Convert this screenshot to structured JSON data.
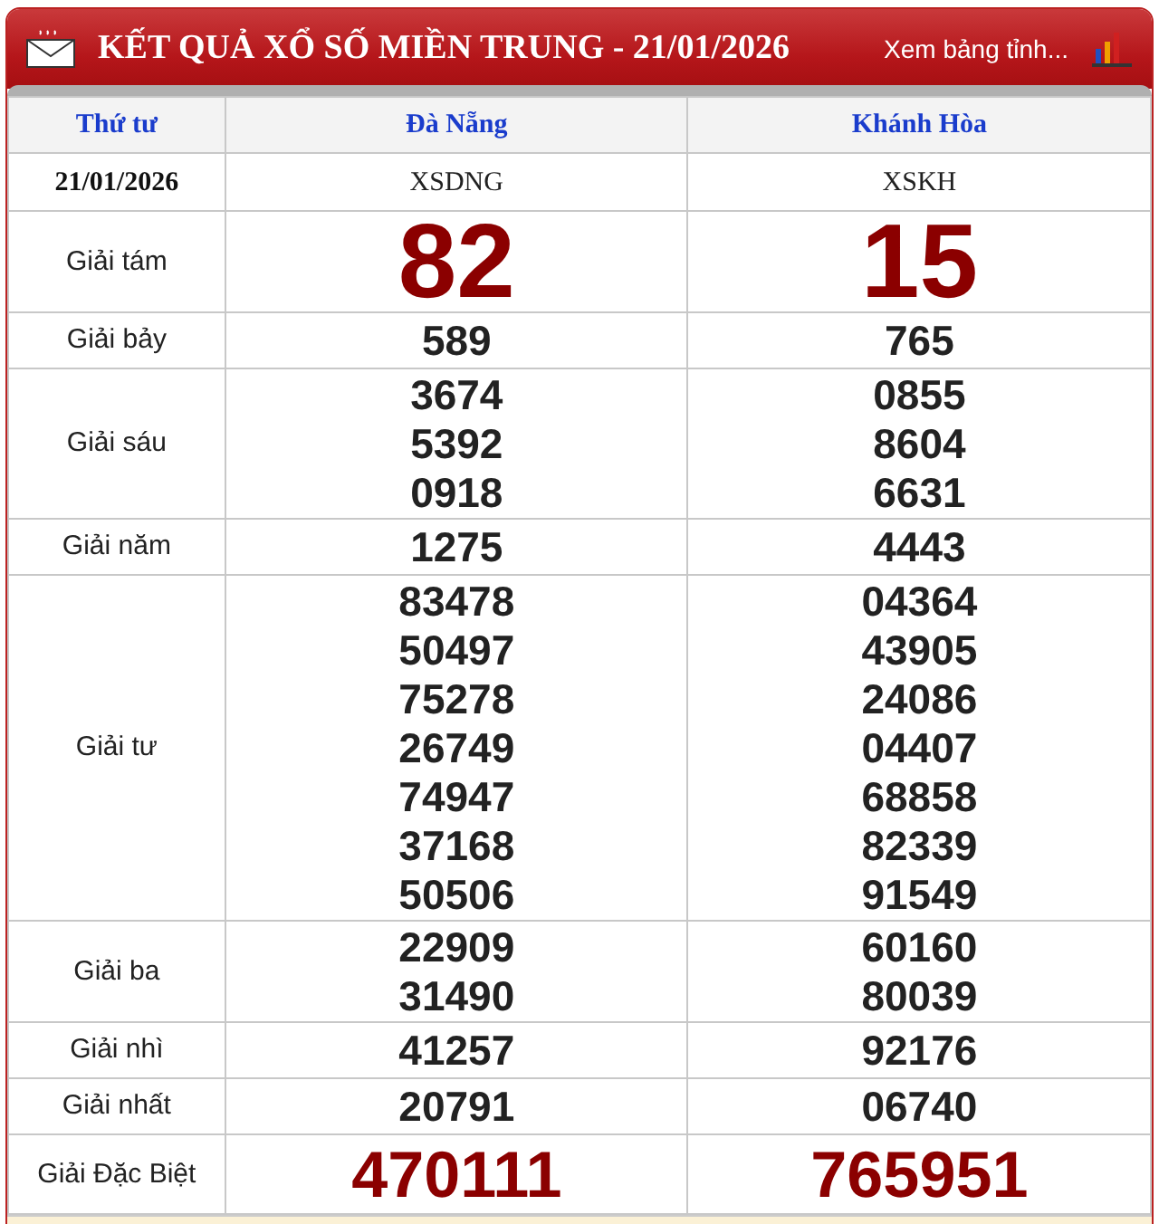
{
  "header": {
    "title": "KẾT QUẢ XỔ SỐ MIỀN TRUNG - 21/01/2026",
    "link": "Xem bảng tỉnh..."
  },
  "columns": [
    "Thứ tư",
    "Đà Nẵng",
    "Khánh Hòa"
  ],
  "code_row": {
    "date": "21/01/2026",
    "codes": [
      "XSDNG",
      "XSKH"
    ]
  },
  "prizes": [
    {
      "label": "Giải tám",
      "kind": "big",
      "results": [
        [
          "82"
        ],
        [
          "15"
        ]
      ]
    },
    {
      "label": "Giải bảy",
      "kind": "normal",
      "results": [
        [
          "589"
        ],
        [
          "765"
        ]
      ]
    },
    {
      "label": "Giải sáu",
      "kind": "normal",
      "results": [
        [
          "3674",
          "5392",
          "0918"
        ],
        [
          "0855",
          "8604",
          "6631"
        ]
      ]
    },
    {
      "label": "Giải năm",
      "kind": "normal",
      "results": [
        [
          "1275"
        ],
        [
          "4443"
        ]
      ]
    },
    {
      "label": "Giải tư",
      "kind": "normal",
      "results": [
        [
          "83478",
          "50497",
          "75278",
          "26749",
          "74947",
          "37168",
          "50506"
        ],
        [
          "04364",
          "43905",
          "24086",
          "04407",
          "68858",
          "82339",
          "91549"
        ]
      ]
    },
    {
      "label": "Giải ba",
      "kind": "normal",
      "results": [
        [
          "22909",
          "31490"
        ],
        [
          "60160",
          "80039"
        ]
      ]
    },
    {
      "label": "Giải nhì",
      "kind": "normal",
      "results": [
        [
          "41257"
        ],
        [
          "92176"
        ]
      ]
    },
    {
      "label": "Giải nhất",
      "kind": "normal",
      "results": [
        [
          "20791"
        ],
        [
          "06740"
        ]
      ]
    },
    {
      "label": "Giải Đặc Biệt",
      "kind": "special",
      "results": [
        [
          "470111"
        ],
        [
          "765951"
        ]
      ]
    }
  ]
}
